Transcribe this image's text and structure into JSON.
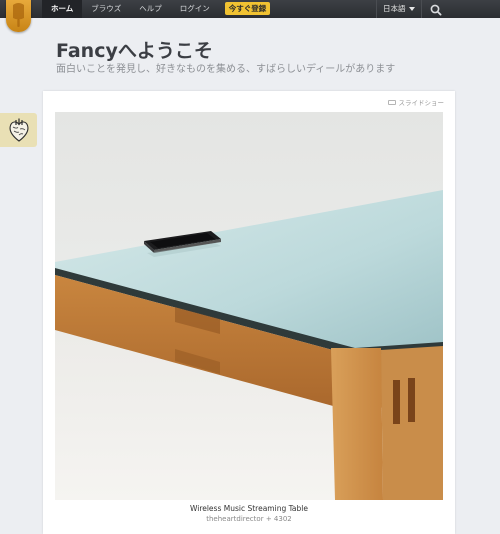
{
  "nav": {
    "items": [
      {
        "label": "ホーム",
        "active": true
      },
      {
        "label": "ブラウズ",
        "active": false
      },
      {
        "label": "ヘルプ",
        "active": false
      },
      {
        "label": "ログイン",
        "active": false
      }
    ],
    "cta": "今すぐ登録",
    "language": "日本語",
    "icons": {
      "logo": "popsicle-logo-icon",
      "search": "search-icon",
      "language_caret": "caret-down-icon"
    }
  },
  "hero": {
    "title": "Fancyへようこそ",
    "subtitle": "面白いことを発見し、好きなものを集める、すばらしいディールがあります"
  },
  "side_badge": {
    "icon": "anatomical-heart-icon"
  },
  "card": {
    "slideshow_label": "スライドショー",
    "slideshow_icon": "slideshow-icon",
    "caption": "Wireless Music Streaming Table",
    "author": "theheartdirector",
    "separator": "+",
    "count": "4302"
  },
  "colors": {
    "nav_bg": "#2b2d31",
    "cta": "#f1c232",
    "logo": "#e0a030",
    "badge_bg": "#e9e0b5"
  }
}
